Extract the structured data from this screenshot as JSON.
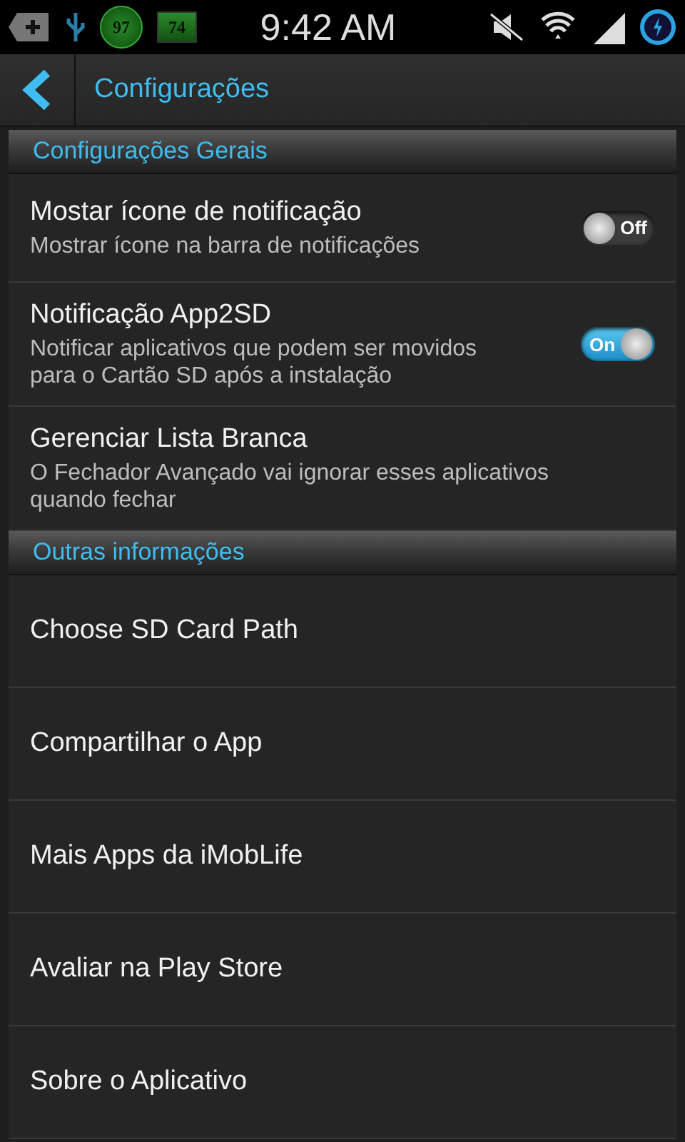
{
  "status_bar": {
    "temperature": "97",
    "battery": "74",
    "time": "9:42 AM"
  },
  "header": {
    "title": "Configurações"
  },
  "sections": [
    {
      "title": "Configurações Gerais",
      "items": [
        {
          "kind": "toggle",
          "title": "Mostar ícone de notificação",
          "summary": "Mostrar ícone na barra de notificações",
          "on": false,
          "switch_label": "Off"
        },
        {
          "kind": "toggle",
          "title": "Notificação App2SD",
          "summary": "Notificar aplicativos que podem ser movidos para o Cartão SD após a instalação",
          "on": true,
          "switch_label": "On"
        },
        {
          "kind": "text",
          "title": "Gerenciar Lista Branca",
          "summary": "O Fechador Avançado vai ignorar esses aplicativos quando fechar"
        }
      ]
    },
    {
      "title": "Outras informações",
      "items": [
        {
          "kind": "plain",
          "title": "Choose SD Card Path"
        },
        {
          "kind": "plain",
          "title": "Compartilhar o App"
        },
        {
          "kind": "plain",
          "title": "Mais Apps da iMobLife"
        },
        {
          "kind": "plain",
          "title": "Avaliar na Play Store"
        },
        {
          "kind": "plain",
          "title": "Sobre o Aplicativo"
        }
      ]
    }
  ]
}
